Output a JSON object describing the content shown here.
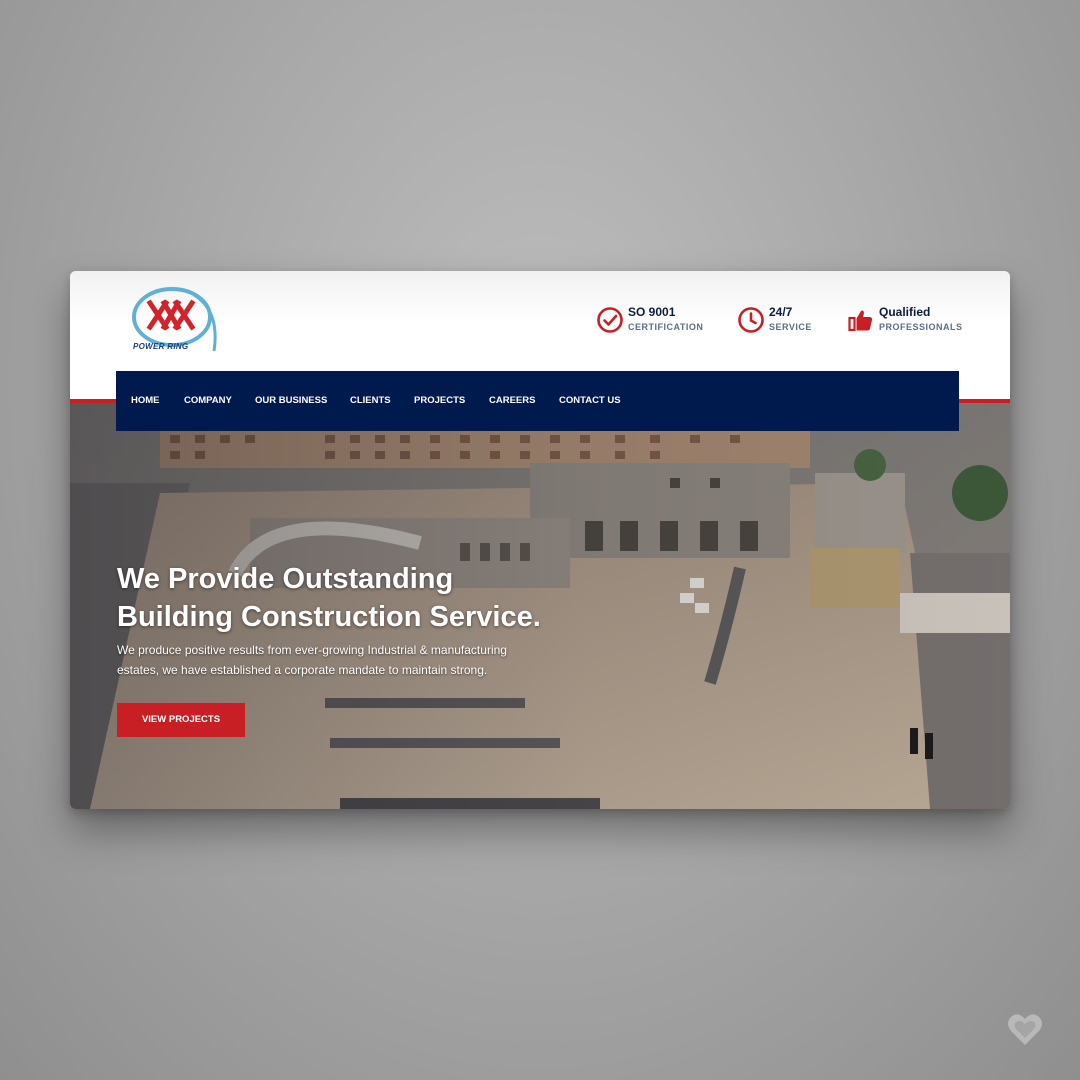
{
  "brand": {
    "name": "POWER RING",
    "colors": {
      "navy": "#001a4e",
      "red": "#c81f24",
      "logo_blue": "#5fb0d6"
    }
  },
  "features": [
    {
      "icon": "check-circle-icon",
      "title": "SO 9001",
      "subtitle": "CERTIFICATION"
    },
    {
      "icon": "clock-icon",
      "title": "24/7",
      "subtitle": "SERVICE"
    },
    {
      "icon": "thumbs-up-icon",
      "title": "Qualified",
      "subtitle": "PROFESSIONALS"
    }
  ],
  "nav": {
    "items": [
      {
        "label": "HOME"
      },
      {
        "label": "COMPANY"
      },
      {
        "label": "OUR BUSINESS"
      },
      {
        "label": "CLIENTS"
      },
      {
        "label": "PROJECTS"
      },
      {
        "label": "CAREERS"
      },
      {
        "label": "CONTACT US"
      }
    ]
  },
  "hero": {
    "title_line1": "We Provide Outstanding",
    "title_line2": "Building Construction Service.",
    "description_line1": "We produce positive results from ever-growing Industrial & manufacturing",
    "description_line2": "estates, we have established a corporate mandate to maintain strong.",
    "cta_label": "VIEW PROJECTS"
  }
}
